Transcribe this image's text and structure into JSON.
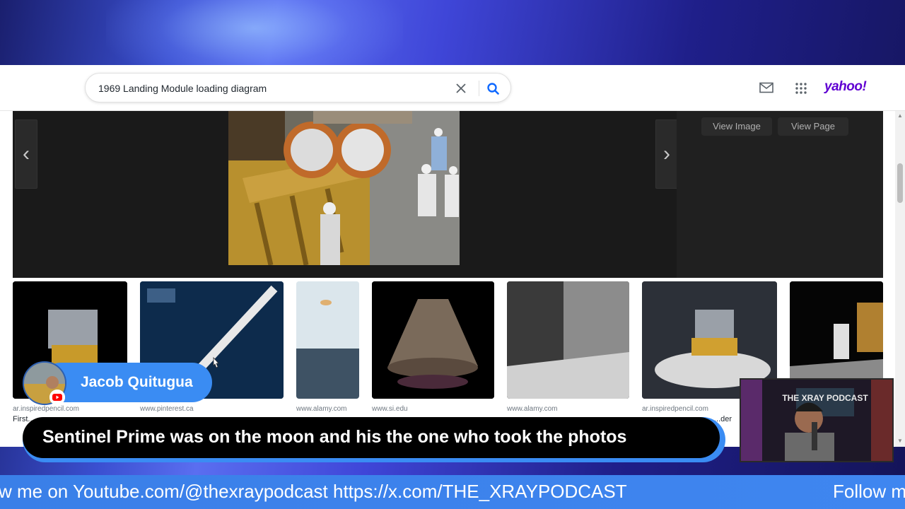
{
  "search": {
    "query": "1969 Landing Module loading diagram"
  },
  "header": {
    "logo": "yahoo!"
  },
  "viewer": {
    "view_image_label": "View Image",
    "view_page_label": "View Page",
    "prev_arrow": "‹",
    "next_arrow": "›"
  },
  "thumbnails": [
    {
      "source": "ar.inspiredpencil.com",
      "title": "First..."
    },
    {
      "source": "www.pinterest.ca",
      "title": ""
    },
    {
      "source": "www.alamy.com",
      "title": ""
    },
    {
      "source": "www.si.edu",
      "title": ""
    },
    {
      "source": "www.alamy.com",
      "title": ""
    },
    {
      "source": "ar.inspiredpencil.com",
      "title": "...der"
    },
    {
      "source": "",
      "title": ""
    }
  ],
  "overlay": {
    "streamer_name": "Jacob Quitugua",
    "caption": "Sentinel Prime was on the moon and his the one who took the photos",
    "ticker_a": "w me on Youtube.com/@thexraypodcast https://x.com/THE_XRAYPODCAST",
    "ticker_b": "Follow m",
    "webcam_sign": "THE XRAY PODCAST"
  },
  "colors": {
    "accent_blue": "#3a8cf3",
    "yahoo_purple": "#6001d2",
    "search_blue": "#0f69ff"
  }
}
